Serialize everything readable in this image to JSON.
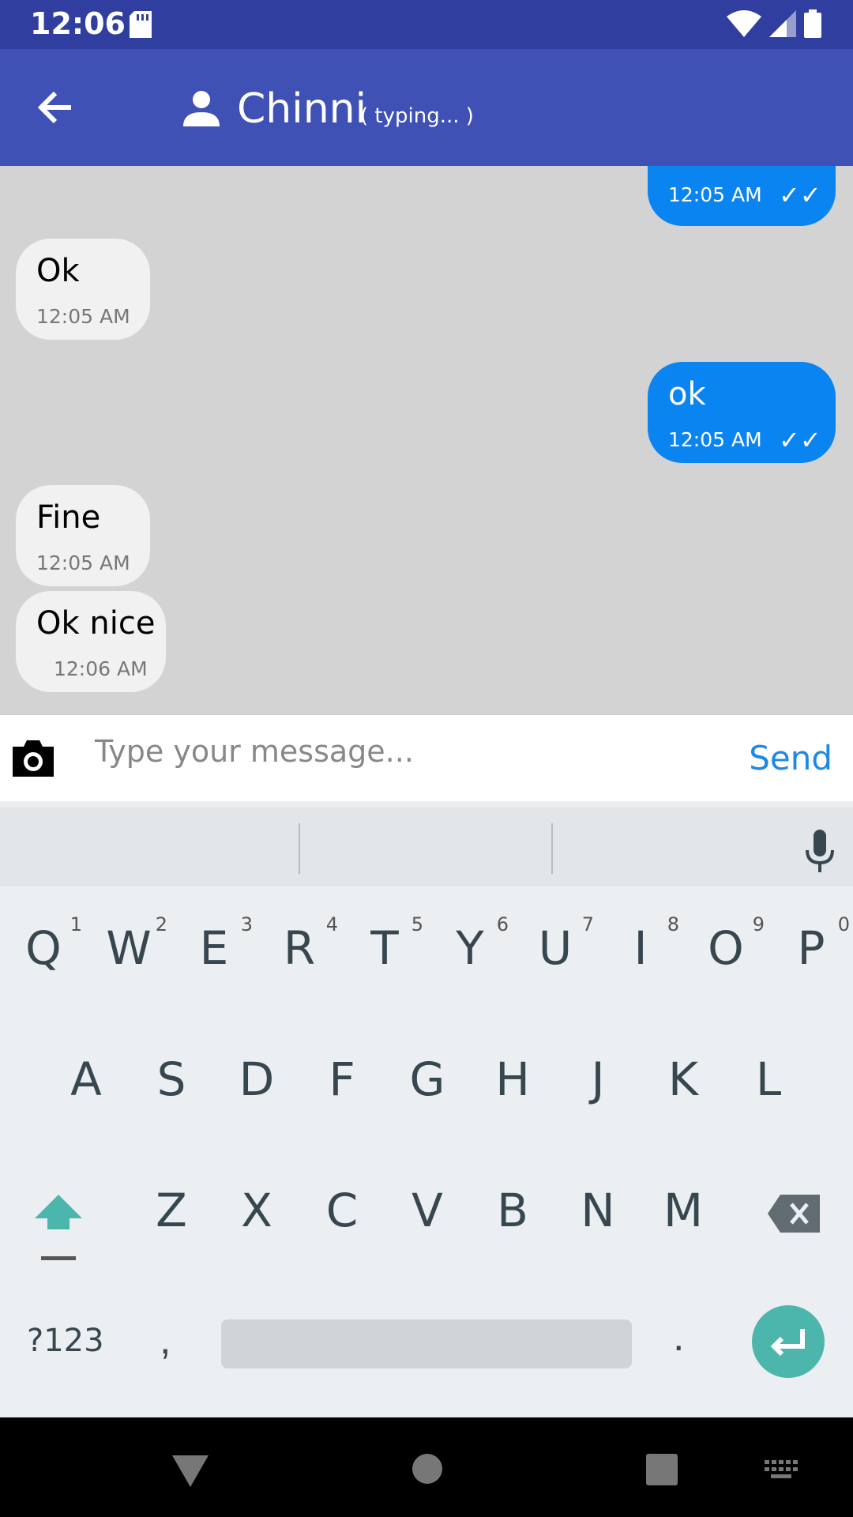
{
  "status": {
    "time": "12:06"
  },
  "header": {
    "title": "Chinni",
    "subtitle": "( typing... )"
  },
  "messages": [
    {
      "dir": "out",
      "text": "",
      "time": "12:05 AM",
      "ticks": "✓✓"
    },
    {
      "dir": "in",
      "text": "Ok",
      "time": "12:05 AM"
    },
    {
      "dir": "out",
      "text": "ok",
      "time": "12:05 AM",
      "ticks": "✓✓"
    },
    {
      "dir": "in",
      "text": "Fine",
      "time": "12:05 AM"
    },
    {
      "dir": "in",
      "text": "Ok nice",
      "time": "12:06 AM"
    }
  ],
  "composer": {
    "placeholder": "Type your message...",
    "send_label": "Send"
  },
  "keyboard": {
    "row1": [
      "Q",
      "W",
      "E",
      "R",
      "T",
      "Y",
      "U",
      "I",
      "O",
      "P"
    ],
    "row1_hints": [
      "1",
      "2",
      "3",
      "4",
      "5",
      "6",
      "7",
      "8",
      "9",
      "0"
    ],
    "row2": [
      "A",
      "S",
      "D",
      "F",
      "G",
      "H",
      "J",
      "K",
      "L"
    ],
    "row3": [
      "Z",
      "X",
      "C",
      "V",
      "B",
      "N",
      "M"
    ],
    "symbols_label": "?123",
    "comma": ",",
    "period": "."
  },
  "icons": {
    "back": "arrow-back-icon",
    "person": "person-icon",
    "camera": "camera-icon",
    "mic": "mic-icon",
    "shift": "shift-icon",
    "backspace": "backspace-icon",
    "enter": "enter-icon"
  },
  "colors": {
    "statusbar": "#303F9F",
    "appbar": "#3F51B5",
    "outgoing": "#0A84F0",
    "incoming": "#F1F1F1",
    "send": "#1E88E5",
    "accent": "#4DB6AC"
  }
}
